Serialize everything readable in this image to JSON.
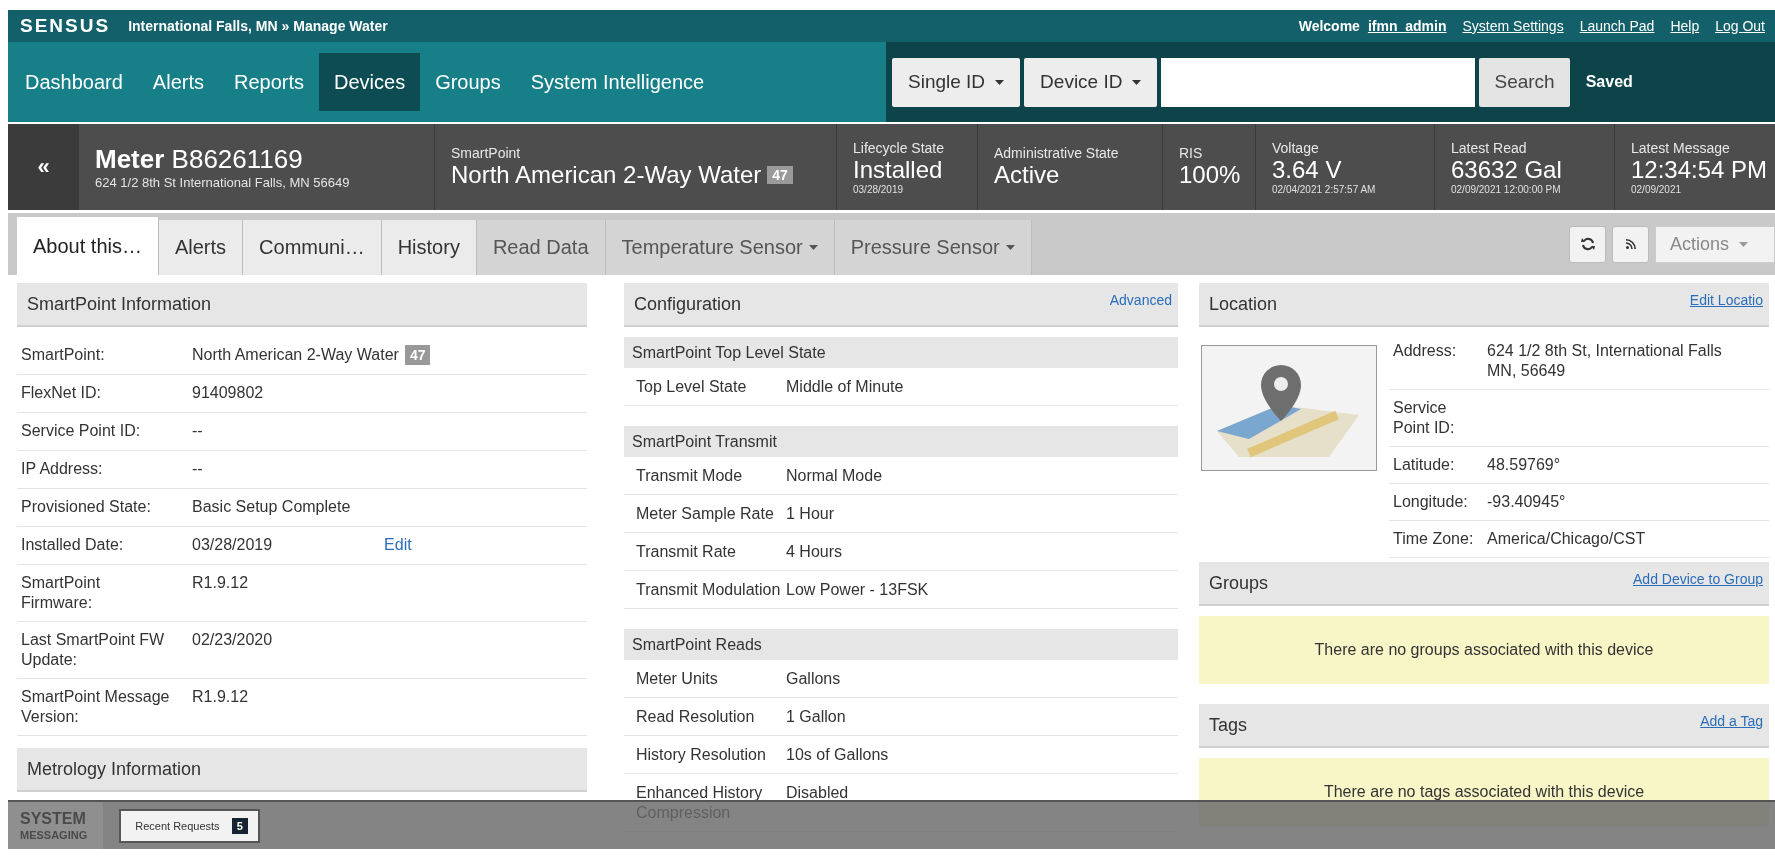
{
  "header": {
    "logo": "SENSUS",
    "location": "International Falls, MN",
    "separator": "»",
    "page": "Manage Water",
    "welcome": "Welcome",
    "user": "ifmn_admin",
    "links": [
      "System Settings",
      "Launch Pad",
      "Help",
      "Log Out"
    ]
  },
  "nav": {
    "items": [
      {
        "label": "Dashboard",
        "selected": false
      },
      {
        "label": "Alerts",
        "selected": false
      },
      {
        "label": "Reports",
        "selected": false
      },
      {
        "label": "Devices",
        "selected": true
      },
      {
        "label": "Groups",
        "selected": false
      },
      {
        "label": "System Intelligence",
        "selected": false
      }
    ],
    "search": {
      "scope": "Single ID",
      "id_type": "Device ID",
      "button": "Search",
      "status": "Saved"
    }
  },
  "meter": {
    "collapse": "«",
    "label": "Meter",
    "id": "B86261169",
    "address": "624 1/2 8th St International Falls, MN 56649",
    "stats": [
      {
        "label": "SmartPoint",
        "value": "North American 2-Way Water",
        "badge": "47"
      },
      {
        "label": "Lifecycle State",
        "value": "Installed",
        "sub": "03/28/2019"
      },
      {
        "label": "Administrative State",
        "value": "Active"
      },
      {
        "label": "RIS",
        "value": "100%"
      },
      {
        "label": "Voltage",
        "value": "3.64 V",
        "sub": "02/04/2021 2:57:57 AM"
      },
      {
        "label": "Latest Read",
        "value": "63632 Gal",
        "sub": "02/09/2021 12:00:00 PM"
      },
      {
        "label": "Latest Message",
        "value": "12:34:54 PM",
        "sub": "02/09/2021"
      }
    ]
  },
  "tabs": {
    "items": [
      {
        "label": "About this…",
        "selected": true,
        "loaded": true,
        "dropdown": false
      },
      {
        "label": "Alerts",
        "selected": false,
        "loaded": true,
        "dropdown": false
      },
      {
        "label": "Communi…",
        "selected": false,
        "loaded": true,
        "dropdown": false
      },
      {
        "label": "History",
        "selected": false,
        "loaded": true,
        "dropdown": false
      },
      {
        "label": "Read Data",
        "selected": false,
        "loaded": false,
        "dropdown": false
      },
      {
        "label": "Temperature Sensor",
        "selected": false,
        "loaded": false,
        "dropdown": true
      },
      {
        "label": "Pressure Sensor",
        "selected": false,
        "loaded": false,
        "dropdown": true
      }
    ],
    "actions": "Actions"
  },
  "columns": [
    {
      "panels": [
        {
          "kind": "rows",
          "title": "SmartPoint Information",
          "rows": [
            {
              "label": "SmartPoint:",
              "value": "North American 2-Way Water",
              "badge": "47"
            },
            {
              "label": "FlexNet ID:",
              "value": "91409802"
            },
            {
              "label": "Service Point ID:",
              "value": "--"
            },
            {
              "label": "IP Address:",
              "value": "--"
            },
            {
              "label": "Provisioned State:",
              "value": "Basic Setup Complete"
            },
            {
              "label": "Installed Date:",
              "value": "03/28/2019",
              "action": "Edit"
            },
            {
              "label": "SmartPoint Firmware:",
              "value": "R1.9.12"
            },
            {
              "label": "Last SmartPoint FW Update:",
              "value": "02/23/2020"
            },
            {
              "label": "SmartPoint Message Version:",
              "value": "R1.9.12"
            }
          ]
        },
        {
          "kind": "rows",
          "title": "Metrology Information"
        }
      ]
    },
    {
      "panels": [
        {
          "kind": "sections",
          "title": "Configuration",
          "link": "Advanced",
          "sections": [
            {
              "title": "SmartPoint Top Level State",
              "rows": [
                {
                  "label": "Top Level State",
                  "value": "Middle of Minute"
                }
              ]
            },
            {
              "title": "SmartPoint Transmit",
              "rows": [
                {
                  "label": "Transmit Mode",
                  "value": "Normal Mode"
                },
                {
                  "label": "Meter Sample Rate",
                  "value": "1 Hour"
                },
                {
                  "label": "Transmit Rate",
                  "value": "4 Hours"
                },
                {
                  "label": "Transmit Modulation",
                  "value": "Low Power - 13FSK"
                }
              ]
            },
            {
              "title": "SmartPoint Reads",
              "rows": [
                {
                  "label": "Meter Units",
                  "value": "Gallons"
                },
                {
                  "label": "Read Resolution",
                  "value": "1 Gallon"
                },
                {
                  "label": "History Resolution",
                  "value": "10s of Gallons"
                },
                {
                  "label": "Enhanced History Compression",
                  "value": "Disabled"
                }
              ]
            }
          ]
        }
      ]
    },
    {
      "panels": [
        {
          "kind": "location",
          "title": "Location",
          "link": "Edit Locatio",
          "rows": [
            {
              "label": "Address:",
              "value": "624 1/2 8th St, International Falls MN, 56649"
            },
            {
              "label": "Service Point ID:"
            },
            {
              "label": "Latitude:",
              "value": "48.59769°"
            },
            {
              "label": "Longitude:",
              "value": "-93.40945°"
            },
            {
              "label": "Time Zone:",
              "value": "America/Chicago/CST"
            }
          ]
        },
        {
          "kind": "empty",
          "title": "Groups",
          "link": "Add Device to Group",
          "message": "There are no groups associated with this device"
        },
        {
          "kind": "empty",
          "title": "Tags",
          "link": "Add a Tag",
          "message": "There are no tags associated with this device"
        }
      ]
    }
  ],
  "messaging": {
    "title_top": "SYSTEM",
    "title_bottom": "MESSAGING",
    "button": "Recent Requests",
    "count": "5"
  }
}
